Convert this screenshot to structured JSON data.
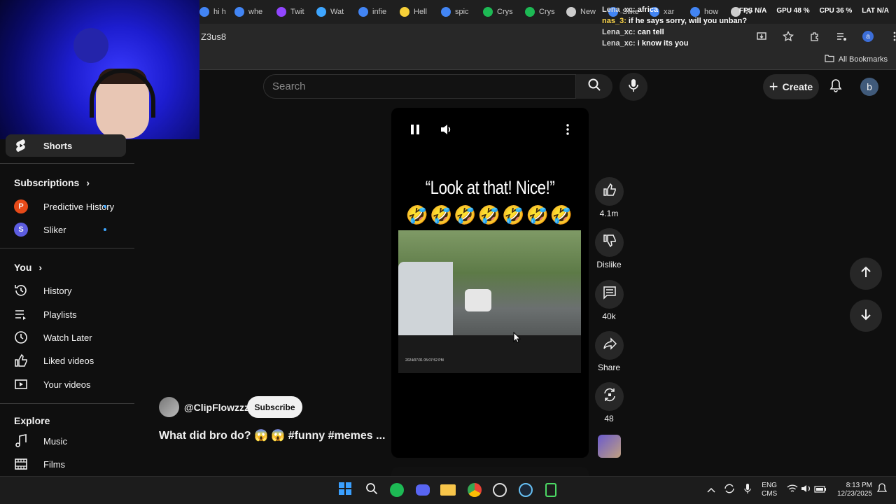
{
  "browser": {
    "tabs": [
      {
        "label": "hi h",
        "color": "#4285f4"
      },
      {
        "label": "whe",
        "color": "#4285f4"
      },
      {
        "label": "Twit",
        "color": "#9146ff"
      },
      {
        "label": "Wat",
        "color": "#3ea6ff"
      },
      {
        "label": "infie",
        "color": "#4285f4"
      },
      {
        "label": "Hell",
        "color": "#f7d038"
      },
      {
        "label": "spic",
        "color": "#4285f4"
      },
      {
        "label": "Crys",
        "color": "#1db954"
      },
      {
        "label": "Crys",
        "color": "#1db954"
      },
      {
        "label": "New",
        "color": "#cccccc"
      },
      {
        "label": "Slike",
        "color": "#4285f4"
      },
      {
        "label": "xar",
        "color": "#4285f4"
      },
      {
        "label": "how",
        "color": "#4285f4"
      },
      {
        "label": "W",
        "color": "#cccccc"
      }
    ],
    "url_fragment": "Z3us8",
    "all_bookmarks": "All Bookmarks"
  },
  "stats": {
    "fps": "FPS N/A",
    "gpu": "GPU 48 %",
    "cpu": "CPU 36 %",
    "lat": "LAT N/A"
  },
  "chat": [
    {
      "user": "Lena_xc:",
      "msg": "africa",
      "alt": false
    },
    {
      "user": "nas_3:",
      "msg": "if he says sorry, will you unban?",
      "alt": true
    },
    {
      "user": "Lena_xc:",
      "msg": "can tell",
      "alt": false
    },
    {
      "user": "Lena_xc:",
      "msg": "i know its you",
      "alt": false
    }
  ],
  "header": {
    "search_placeholder": "Search",
    "create_label": "Create",
    "avatar_letter": "b"
  },
  "sidebar": {
    "shorts": "Shorts",
    "subscriptions_heading": "Subscriptions",
    "subscriptions": [
      {
        "name": "Predictive History",
        "initial": "P",
        "color": "#e64a19"
      },
      {
        "name": "Sliker",
        "initial": "S",
        "color": "#5c5ce0"
      }
    ],
    "you_heading": "You",
    "you_items": [
      "History",
      "Playlists",
      "Watch Later",
      "Liked videos",
      "Your videos"
    ],
    "explore_heading": "Explore",
    "explore_items": [
      "Music",
      "Films"
    ]
  },
  "short": {
    "quote": "“Look at that! Nice!”",
    "emojis": "🤣🤣🤣🤣🤣🤣🤣",
    "channel": "@ClipFlowzzz",
    "subscribe_label": "Subscribe",
    "title": "What did bro do? 😱 😱 #funny #memes ...",
    "timestamp": "2024/07/31 05:07:52 PM"
  },
  "actions": {
    "likes": "4.1m",
    "dislike_label": "Dislike",
    "comments": "40k",
    "share_label": "Share",
    "remix": "48"
  },
  "taskbar": {
    "lang_line1": "ENG",
    "lang_line2": "CMS",
    "time": "8:13 PM",
    "date": "12/23/2025"
  }
}
